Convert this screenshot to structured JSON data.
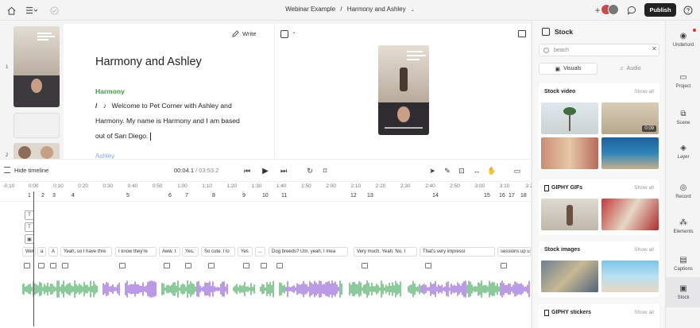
{
  "topbar": {
    "project": "Webinar Example",
    "separator": "/",
    "composition": "Harmony and Ashley",
    "publish_label": "Publish"
  },
  "editor": {
    "write_label": "Write",
    "title": "Harmony and Ashley",
    "speaker": "Harmony",
    "transcript": "Welcome to Pet Corner with Ashley and Harmony. My name is Harmony and I am based out of San Diego.",
    "next_speaker": "Ashley",
    "thumb_numbers": [
      "1",
      "2"
    ]
  },
  "transport": {
    "hide_timeline_label": "Hide timeline",
    "current_time": "00:04.1",
    "duration": "/  03:53.2"
  },
  "timeline": {
    "ruler_ticks": [
      "-0:10",
      "0:00",
      "0:10",
      "0:20",
      "0:30",
      "0:40",
      "0:50",
      "1:00",
      "1:10",
      "1:20",
      "1:30",
      "1:40",
      "1:50",
      "2:00",
      "2:10",
      "2:20",
      "2:30",
      "2:40",
      "2:50",
      "3:00",
      "3:10",
      "3:2"
    ],
    "scenes": [
      "1",
      "2",
      "3",
      "4",
      "5",
      "6",
      "7",
      "8",
      "9",
      "10",
      "11",
      "12",
      "13",
      "14",
      "15",
      "16",
      "17",
      "18"
    ],
    "track_icons": [
      "T",
      "T",
      "▣"
    ],
    "captions": [
      "Wel",
      "a",
      "A",
      "Yeah, so I have thre",
      "I know they're",
      "Aww, t",
      "Yes,",
      "So cute. I lo",
      "Yes",
      "...",
      "Dog breeds? Um, yeah, I mea",
      "Very much. Yeah. No, I",
      "That's very impressi",
      "sessions up until"
    ]
  },
  "stock": {
    "title": "Stock",
    "search_value": "beach",
    "tabs": [
      "Visuals",
      "Audio"
    ],
    "sections": [
      {
        "title": "Stock video",
        "show_all": "Show all",
        "badge": "0:09"
      },
      {
        "title": "GIPHY GIFs",
        "show_all": "Show all"
      },
      {
        "title": "Stock images",
        "show_all": "Show all"
      },
      {
        "title": "GIPHY stickers",
        "show_all": "Show all"
      }
    ]
  },
  "rail": {
    "items": [
      "Underlord",
      "Project",
      "Scene",
      "Layer",
      "Record",
      "Elements",
      "Captions",
      "Stock"
    ]
  },
  "colors": {
    "publish_bg": "#222222",
    "speaker_green": "#3a9d46",
    "waveform_green": "#3fa65a",
    "waveform_purple": "#8e58d6"
  }
}
